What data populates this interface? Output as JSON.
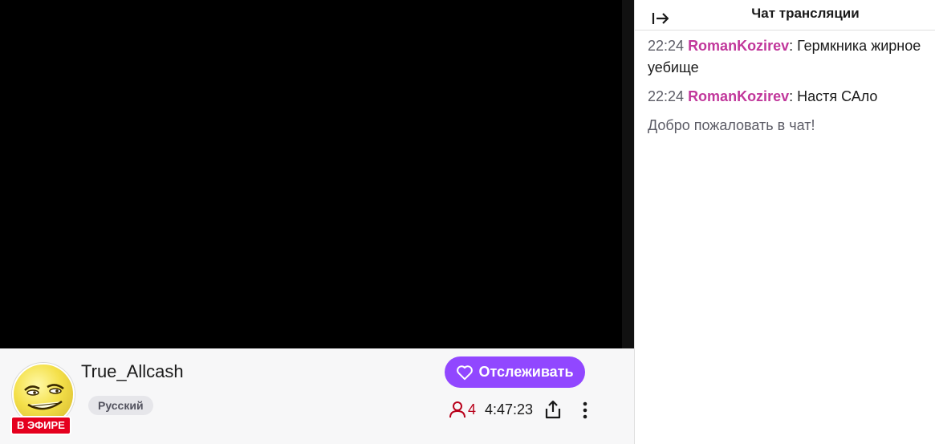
{
  "player": {
    "background": "#000000"
  },
  "channel": {
    "name": "True_Allcash",
    "live_badge": "В ЭФИРЕ",
    "language": "Русский",
    "follow_label": "Отслеживать",
    "viewer_count": "4",
    "uptime": "4:47:23",
    "icons": [
      "heart-icon",
      "viewer-icon",
      "share-icon",
      "more-icon"
    ]
  },
  "chat": {
    "title": "Чат трансляции",
    "collapse_icon": "collapse-arrow-icon",
    "messages": [
      {
        "time": "22:24",
        "user": "RomanKozirev",
        "text": ": Гермкника жирное уебище"
      },
      {
        "time": "22:24",
        "user": "RomanKozirev",
        "text": ": Настя САло"
      }
    ],
    "welcome": "Добро пожаловать в чат!"
  },
  "colors": {
    "accent": "#9147ff",
    "live": "#e5001e",
    "username": "#c1379b",
    "viewer": "#b8001a"
  }
}
